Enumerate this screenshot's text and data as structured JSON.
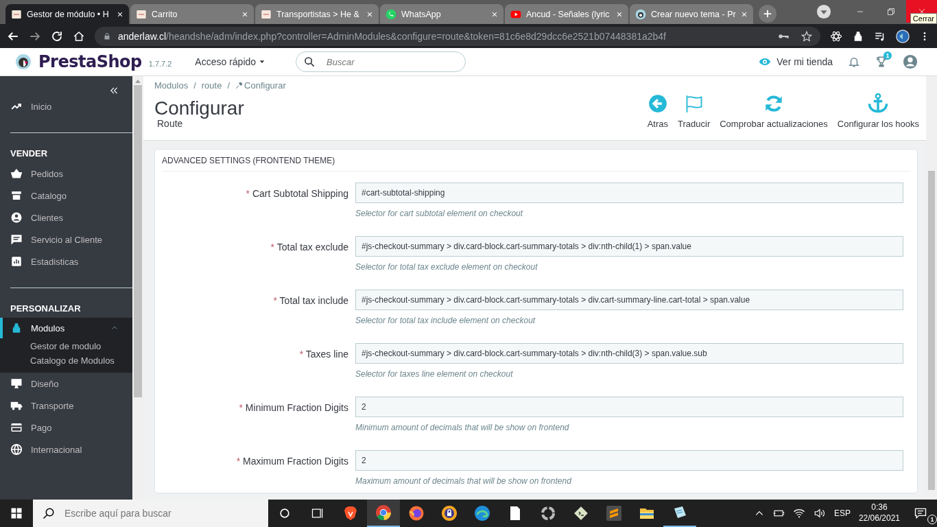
{
  "browser": {
    "tabs": [
      {
        "title": "Gestor de módulo • H",
        "selected": true
      },
      {
        "title": "Carrito",
        "selected": false
      },
      {
        "title": "Transportistas > He &",
        "selected": false
      },
      {
        "title": "WhatsApp",
        "selected": false
      },
      {
        "title": "Ancud - Señales (lyric",
        "selected": false
      },
      {
        "title": "Crear nuevo tema - Pr",
        "selected": false
      }
    ],
    "tooltip": "Cerrar",
    "url_host": "anderlaw.cl",
    "url_path": "/heandshe/adm/index.php?controller=AdminModules&configure=route&token=81c6e8d29dcc6e2521b07448381a2b4f"
  },
  "header": {
    "logo": "PrestaShop",
    "version": "1.7.7.2",
    "quick_access": "Acceso rápido",
    "search_placeholder": "Buscar",
    "view_store": "Ver mi tienda",
    "trophy_badge": "1"
  },
  "sidebar": {
    "groups": [
      {
        "items": [
          {
            "label": "Inicio",
            "selected": false
          }
        ]
      },
      {
        "heading": "VENDER",
        "items": [
          {
            "label": "Pedidos",
            "selected": false
          },
          {
            "label": "Catalogo",
            "selected": false
          },
          {
            "label": "Clientes",
            "selected": false
          },
          {
            "label": "Servicio al Cliente",
            "selected": false
          },
          {
            "label": "Estadisticas",
            "selected": false
          }
        ]
      },
      {
        "heading": "PERSONALIZAR",
        "items": [
          {
            "label": "Modulos",
            "selected": true,
            "expanded": true,
            "children": [
              "Gestor de modulo",
              "Catalogo de Modulos"
            ]
          },
          {
            "label": "Diseño",
            "selected": false
          },
          {
            "label": "Transporte",
            "selected": false
          },
          {
            "label": "Pago",
            "selected": false
          },
          {
            "label": "Internacional",
            "selected": false
          }
        ]
      }
    ]
  },
  "breadcrumb": {
    "items": [
      "Modulos",
      "route",
      "Configurar"
    ],
    "separator": "/"
  },
  "page_title": "Configurar",
  "page_subtitle": "Route",
  "toolbar": [
    {
      "label": "Atras",
      "kind": "back"
    },
    {
      "label": "Traducir",
      "kind": "flag"
    },
    {
      "label": "Comprobar actualizaciones",
      "kind": "refresh"
    },
    {
      "label": "Configurar los hooks",
      "kind": "anchor"
    }
  ],
  "panel": {
    "title": "ADVANCED SETTINGS (FRONTEND THEME)",
    "required_mark": "*",
    "fields": [
      {
        "label": "Cart Subtotal Shipping",
        "required": true,
        "value": "#cart-subtotal-shipping",
        "help": "Selector for cart subtotal element on checkout"
      },
      {
        "label": "Total tax exclude",
        "required": true,
        "value": "#js-checkout-summary > div.card-block.cart-summary-totals > div:nth-child(1) > span.value",
        "help": "Selector for total tax exclude element on checkout"
      },
      {
        "label": "Total tax include",
        "required": true,
        "value": "#js-checkout-summary > div.card-block.cart-summary-totals > div.cart-summary-line.cart-total > span.value",
        "help": "Selector for total tax include element on checkout"
      },
      {
        "label": "Taxes line",
        "required": true,
        "value": "#js-checkout-summary > div.card-block.cart-summary-totals > div:nth-child(3) > span.value.sub",
        "help": "Selector for taxes line element on checkout"
      },
      {
        "label": "Minimum Fraction Digits",
        "required": true,
        "value": "2",
        "help": "Minimum amount of decimals that will be show on frontend"
      },
      {
        "label": "Maximum Fraction Digits",
        "required": true,
        "value": "2",
        "help": "Maximum amount of decimals that will be show on frontend"
      }
    ]
  },
  "taskbar": {
    "search_placeholder": "Escribe aquí para buscar",
    "apps": [
      {
        "kind": "cortana",
        "running": false
      },
      {
        "kind": "taskview",
        "running": false
      },
      {
        "kind": "brave",
        "running": false
      },
      {
        "kind": "chrome",
        "running": true
      },
      {
        "kind": "firefox",
        "running": false
      },
      {
        "kind": "vpn",
        "running": false
      },
      {
        "kind": "edge",
        "running": false
      },
      {
        "kind": "file",
        "running": false
      },
      {
        "kind": "recorder",
        "running": false
      },
      {
        "kind": "terminal",
        "running": false
      },
      {
        "kind": "sublime",
        "running": false
      },
      {
        "kind": "folder",
        "running": false
      },
      {
        "kind": "notepad",
        "running": true
      }
    ],
    "language": "ESP",
    "time": "0:36",
    "date": "22/06/2021",
    "notification_badge": "1"
  }
}
